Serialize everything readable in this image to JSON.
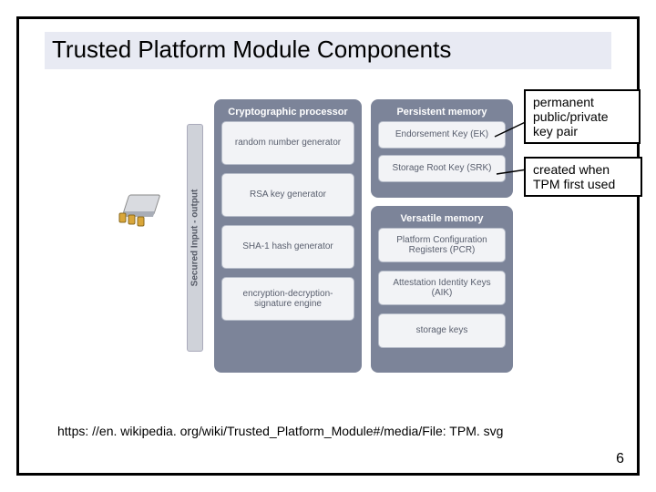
{
  "title": "Trusted Platform Module Components",
  "io_label": "Secured Input - output",
  "columns": {
    "crypto": {
      "title": "Cryptographic processor",
      "cells": [
        "random number generator",
        "RSA key generator",
        "SHA-1 hash generator",
        "encryption-decryption- signature engine"
      ]
    },
    "persist": {
      "title": "Persistent memory",
      "cells": [
        "Endorsement Key (EK)",
        "Storage Root Key (SRK)"
      ]
    },
    "versatile": {
      "title": "Versatile memory",
      "cells": [
        "Platform Configuration Registers (PCR)",
        "Attestation Identity Keys (AIK)",
        "storage keys"
      ]
    }
  },
  "callouts": {
    "c1": "permanent public/private key pair",
    "c2": "created when TPM first used"
  },
  "citation": "https: //en. wikipedia. org/wiki/Trusted_Platform_Module#/media/File: TPM. svg",
  "pagenum": "6"
}
